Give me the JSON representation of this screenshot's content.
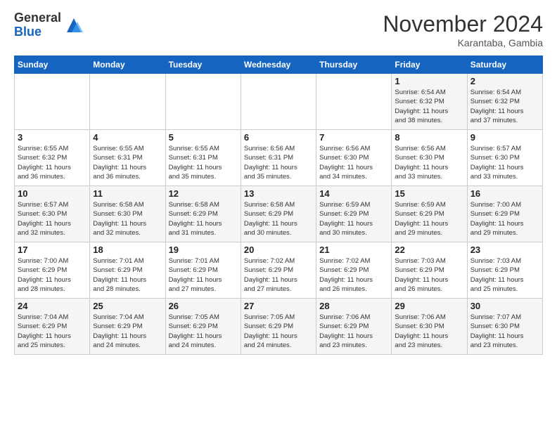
{
  "header": {
    "logo_general": "General",
    "logo_blue": "Blue",
    "month_title": "November 2024",
    "location": "Karantaba, Gambia"
  },
  "weekdays": [
    "Sunday",
    "Monday",
    "Tuesday",
    "Wednesday",
    "Thursday",
    "Friday",
    "Saturday"
  ],
  "weeks": [
    [
      {
        "day": "",
        "info": ""
      },
      {
        "day": "",
        "info": ""
      },
      {
        "day": "",
        "info": ""
      },
      {
        "day": "",
        "info": ""
      },
      {
        "day": "",
        "info": ""
      },
      {
        "day": "1",
        "info": "Sunrise: 6:54 AM\nSunset: 6:32 PM\nDaylight: 11 hours\nand 38 minutes."
      },
      {
        "day": "2",
        "info": "Sunrise: 6:54 AM\nSunset: 6:32 PM\nDaylight: 11 hours\nand 37 minutes."
      }
    ],
    [
      {
        "day": "3",
        "info": "Sunrise: 6:55 AM\nSunset: 6:32 PM\nDaylight: 11 hours\nand 36 minutes."
      },
      {
        "day": "4",
        "info": "Sunrise: 6:55 AM\nSunset: 6:31 PM\nDaylight: 11 hours\nand 36 minutes."
      },
      {
        "day": "5",
        "info": "Sunrise: 6:55 AM\nSunset: 6:31 PM\nDaylight: 11 hours\nand 35 minutes."
      },
      {
        "day": "6",
        "info": "Sunrise: 6:56 AM\nSunset: 6:31 PM\nDaylight: 11 hours\nand 35 minutes."
      },
      {
        "day": "7",
        "info": "Sunrise: 6:56 AM\nSunset: 6:30 PM\nDaylight: 11 hours\nand 34 minutes."
      },
      {
        "day": "8",
        "info": "Sunrise: 6:56 AM\nSunset: 6:30 PM\nDaylight: 11 hours\nand 33 minutes."
      },
      {
        "day": "9",
        "info": "Sunrise: 6:57 AM\nSunset: 6:30 PM\nDaylight: 11 hours\nand 33 minutes."
      }
    ],
    [
      {
        "day": "10",
        "info": "Sunrise: 6:57 AM\nSunset: 6:30 PM\nDaylight: 11 hours\nand 32 minutes."
      },
      {
        "day": "11",
        "info": "Sunrise: 6:58 AM\nSunset: 6:30 PM\nDaylight: 11 hours\nand 32 minutes."
      },
      {
        "day": "12",
        "info": "Sunrise: 6:58 AM\nSunset: 6:29 PM\nDaylight: 11 hours\nand 31 minutes."
      },
      {
        "day": "13",
        "info": "Sunrise: 6:58 AM\nSunset: 6:29 PM\nDaylight: 11 hours\nand 30 minutes."
      },
      {
        "day": "14",
        "info": "Sunrise: 6:59 AM\nSunset: 6:29 PM\nDaylight: 11 hours\nand 30 minutes."
      },
      {
        "day": "15",
        "info": "Sunrise: 6:59 AM\nSunset: 6:29 PM\nDaylight: 11 hours\nand 29 minutes."
      },
      {
        "day": "16",
        "info": "Sunrise: 7:00 AM\nSunset: 6:29 PM\nDaylight: 11 hours\nand 29 minutes."
      }
    ],
    [
      {
        "day": "17",
        "info": "Sunrise: 7:00 AM\nSunset: 6:29 PM\nDaylight: 11 hours\nand 28 minutes."
      },
      {
        "day": "18",
        "info": "Sunrise: 7:01 AM\nSunset: 6:29 PM\nDaylight: 11 hours\nand 28 minutes."
      },
      {
        "day": "19",
        "info": "Sunrise: 7:01 AM\nSunset: 6:29 PM\nDaylight: 11 hours\nand 27 minutes."
      },
      {
        "day": "20",
        "info": "Sunrise: 7:02 AM\nSunset: 6:29 PM\nDaylight: 11 hours\nand 27 minutes."
      },
      {
        "day": "21",
        "info": "Sunrise: 7:02 AM\nSunset: 6:29 PM\nDaylight: 11 hours\nand 26 minutes."
      },
      {
        "day": "22",
        "info": "Sunrise: 7:03 AM\nSunset: 6:29 PM\nDaylight: 11 hours\nand 26 minutes."
      },
      {
        "day": "23",
        "info": "Sunrise: 7:03 AM\nSunset: 6:29 PM\nDaylight: 11 hours\nand 25 minutes."
      }
    ],
    [
      {
        "day": "24",
        "info": "Sunrise: 7:04 AM\nSunset: 6:29 PM\nDaylight: 11 hours\nand 25 minutes."
      },
      {
        "day": "25",
        "info": "Sunrise: 7:04 AM\nSunset: 6:29 PM\nDaylight: 11 hours\nand 24 minutes."
      },
      {
        "day": "26",
        "info": "Sunrise: 7:05 AM\nSunset: 6:29 PM\nDaylight: 11 hours\nand 24 minutes."
      },
      {
        "day": "27",
        "info": "Sunrise: 7:05 AM\nSunset: 6:29 PM\nDaylight: 11 hours\nand 24 minutes."
      },
      {
        "day": "28",
        "info": "Sunrise: 7:06 AM\nSunset: 6:29 PM\nDaylight: 11 hours\nand 23 minutes."
      },
      {
        "day": "29",
        "info": "Sunrise: 7:06 AM\nSunset: 6:30 PM\nDaylight: 11 hours\nand 23 minutes."
      },
      {
        "day": "30",
        "info": "Sunrise: 7:07 AM\nSunset: 6:30 PM\nDaylight: 11 hours\nand 23 minutes."
      }
    ]
  ]
}
